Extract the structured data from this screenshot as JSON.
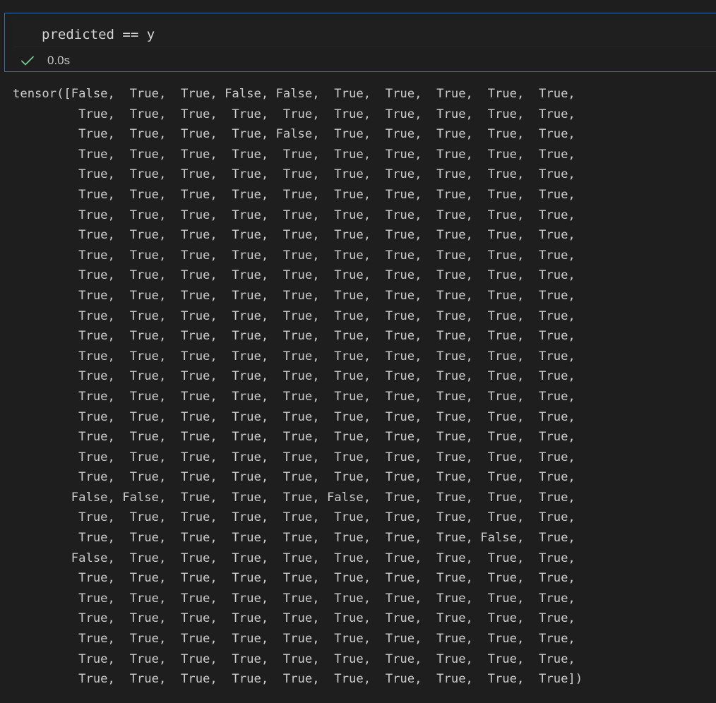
{
  "cell": {
    "code": "predicted == y",
    "status_icon": "check-icon",
    "exec_time": "0.0s"
  },
  "output": {
    "lines": [
      "tensor([False,  True,  True, False, False,  True,  True,  True,  True,  True,",
      "         True,  True,  True,  True,  True,  True,  True,  True,  True,  True,",
      "         True,  True,  True,  True, False,  True,  True,  True,  True,  True,",
      "         True,  True,  True,  True,  True,  True,  True,  True,  True,  True,",
      "         True,  True,  True,  True,  True,  True,  True,  True,  True,  True,",
      "         True,  True,  True,  True,  True,  True,  True,  True,  True,  True,",
      "         True,  True,  True,  True,  True,  True,  True,  True,  True,  True,",
      "         True,  True,  True,  True,  True,  True,  True,  True,  True,  True,",
      "         True,  True,  True,  True,  True,  True,  True,  True,  True,  True,",
      "         True,  True,  True,  True,  True,  True,  True,  True,  True,  True,",
      "         True,  True,  True,  True,  True,  True,  True,  True,  True,  True,",
      "         True,  True,  True,  True,  True,  True,  True,  True,  True,  True,",
      "         True,  True,  True,  True,  True,  True,  True,  True,  True,  True,",
      "         True,  True,  True,  True,  True,  True,  True,  True,  True,  True,",
      "         True,  True,  True,  True,  True,  True,  True,  True,  True,  True,",
      "         True,  True,  True,  True,  True,  True,  True,  True,  True,  True,",
      "         True,  True,  True,  True,  True,  True,  True,  True,  True,  True,",
      "         True,  True,  True,  True,  True,  True,  True,  True,  True,  True,",
      "         True,  True,  True,  True,  True,  True,  True,  True,  True,  True,",
      "         True,  True,  True,  True,  True,  True,  True,  True,  True,  True,",
      "        False, False,  True,  True,  True, False,  True,  True,  True,  True,",
      "         True,  True,  True,  True,  True,  True,  True,  True,  True,  True,",
      "         True,  True,  True,  True,  True,  True,  True,  True, False,  True,",
      "        False,  True,  True,  True,  True,  True,  True,  True,  True,  True,",
      "         True,  True,  True,  True,  True,  True,  True,  True,  True,  True,",
      "         True,  True,  True,  True,  True,  True,  True,  True,  True,  True,",
      "         True,  True,  True,  True,  True,  True,  True,  True,  True,  True,",
      "         True,  True,  True,  True,  True,  True,  True,  True,  True,  True,",
      "         True,  True,  True,  True,  True,  True,  True,  True,  True,  True,",
      "         True,  True,  True,  True,  True,  True,  True,  True,  True,  True])"
    ]
  },
  "colors": {
    "background": "#1e1e1e",
    "cell_border": "#2f6fae",
    "success_check": "#73c991",
    "text": "#cccccc"
  }
}
